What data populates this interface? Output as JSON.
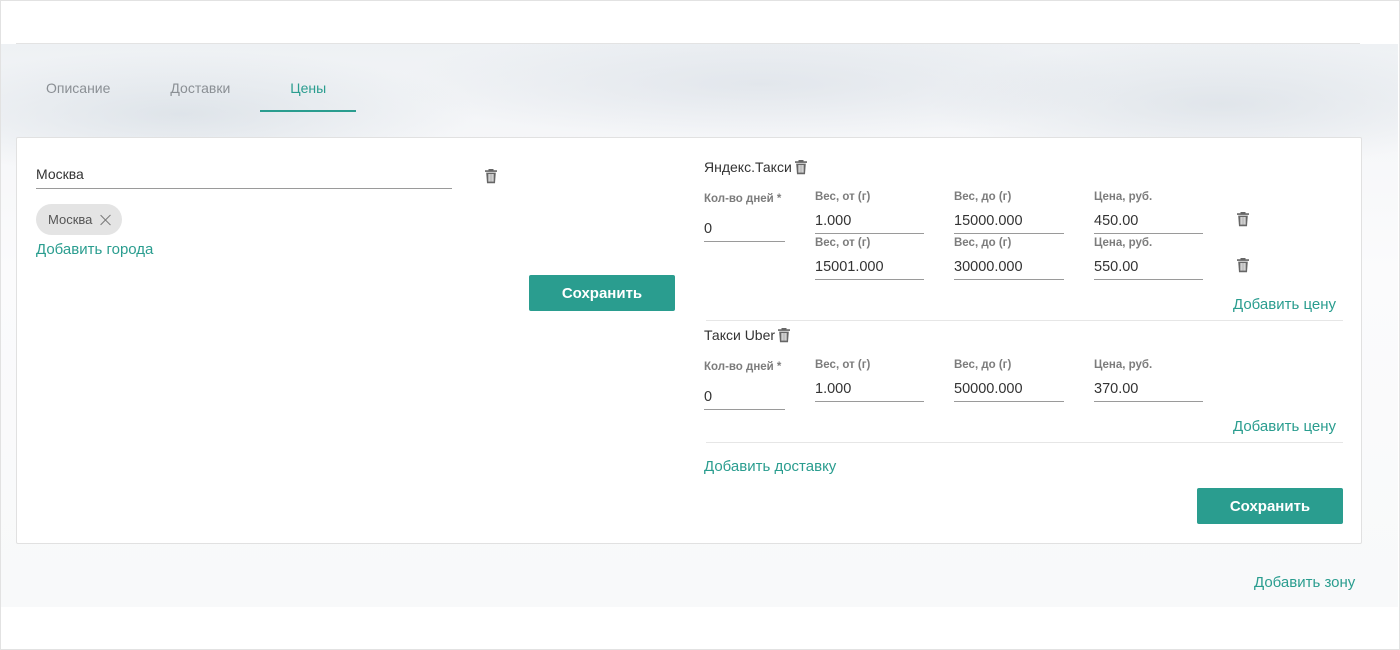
{
  "tabs": [
    {
      "label": "Описание",
      "active": false
    },
    {
      "label": "Доставки",
      "active": false
    },
    {
      "label": "Цены",
      "active": true
    }
  ],
  "zone": {
    "name_value": "Москва",
    "chips": [
      "Москва"
    ],
    "add_cities_label": "Добавить города",
    "save_label": "Сохранить"
  },
  "deliveries": [
    {
      "title": "Яндекс.Такси",
      "days_label": "Кол-во дней *",
      "days_value": "0",
      "prices": [
        {
          "from_label": "Вес, от (г)",
          "from": "1.000",
          "to_label": "Вес, до (г)",
          "to": "15000.000",
          "price_label": "Цена, руб.",
          "price": "450.00"
        },
        {
          "from_label": "Вес, от (г)",
          "from": "15001.000",
          "to_label": "Вес, до (г)",
          "to": "30000.000",
          "price_label": "Цена, руб.",
          "price": "550.00"
        }
      ],
      "add_price_label": "Добавить цену"
    },
    {
      "title": "Такси Uber",
      "days_label": "Кол-во дней *",
      "days_value": "0",
      "prices": [
        {
          "from_label": "Вес, от (г)",
          "from": "1.000",
          "to_label": "Вес, до (г)",
          "to": "50000.000",
          "price_label": "Цена, руб.",
          "price": "370.00"
        }
      ],
      "add_price_label": "Добавить цену"
    }
  ],
  "add_delivery_label": "Добавить доставку",
  "save_label": "Сохранить",
  "add_zone_label": "Добавить зону",
  "colors": {
    "accent": "#2a9d8f",
    "chip_bg": "#e4e4e4",
    "muted_text": "#8a8f94"
  }
}
